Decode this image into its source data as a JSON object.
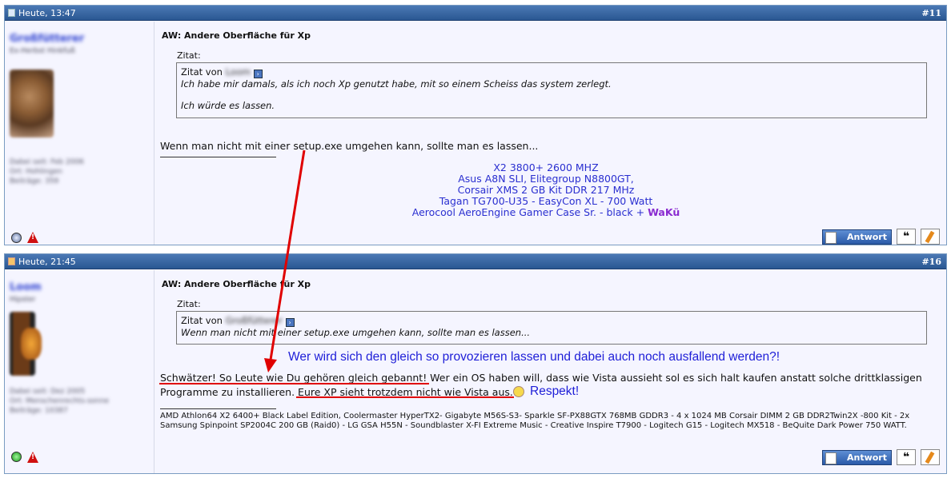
{
  "posts": [
    {
      "time": "Heute, 13:47",
      "number": "#11",
      "username": "Großfütterer",
      "user_title": "Ex-Herbst Hinkfuß",
      "user_meta": [
        "Dabei seit: Feb 2006",
        "Ort: Hohlingen",
        "Beiträge: 359"
      ],
      "title": "AW: Andere Oberfläche für Xp",
      "quote_label": "Zitat:",
      "quote_prefix": "Zitat von",
      "quote_author": "Loom",
      "quote_lines": [
        "Ich habe mir damals, als ich noch Xp genutzt habe, mit so einem Scheiss das system zerlegt.",
        "Ich würde es lassen."
      ],
      "body": "Wenn man nicht mit einer setup.exe umgehen kann, sollte man es lassen...",
      "signature": [
        "X2 3800+ 2600 MHZ",
        "Asus A8N SLI, Elitegroup N8800GT,",
        "Corsair XMS 2 GB Kit DDR 217 MHz",
        "Tagan TG700-U35 - EasyCon XL - 700 Watt",
        "Aerocool AeroEngine Gamer Case Sr. - black + "
      ],
      "signature_bold": "WaKü",
      "reply_label": "Antwort",
      "quote_button": "❝"
    },
    {
      "time": "Heute, 21:45",
      "number": "#16",
      "username": "Loom",
      "user_title": "Hipster",
      "user_meta": [
        "Dabei seit: Dez 2005",
        "Ort: Menschenrechts-sonne",
        "Beiträge: 10387"
      ],
      "title": "AW: Andere Oberfläche für Xp",
      "quote_label": "Zitat:",
      "quote_prefix": "Zitat von",
      "quote_author": "Großfütterer",
      "quote_lines": [
        "Wenn man nicht mit einer setup.exe umgehen kann, sollte man es lassen..."
      ],
      "body_line1": "Schwätzer! So Leute wie Du gehören gleich gebannt! Wer ein OS haben will, dass wie Vista aussieht sol es sich halt kaufen anstatt solche drittklassigen",
      "body_line2": "Programme zu installieren. Eure XP sieht trotzdem nicht wie Vista aus.",
      "signature": "AMD Athlon64 X2 6400+ Black Label Edition, Coolermaster HyperTX2- Gigabyte M56S-S3- Sparkle SF-PX88GTX 768MB GDDR3 - 4 x 1024 MB Corsair DIMM 2 GB DDR2Twin2X -800 Kit - 2x Samsung Spinpoint SP2004C 200 GB (Raid0) - LG GSA H55N - Soundblaster X-FI Extreme Music - Creative Inspire T7900 - Logitech G15 - Logitech MX518 - BeQuite Dark Power 750 WATT.",
      "reply_label": "Antwort",
      "quote_button": "❝"
    }
  ],
  "annotations": {
    "question": "Wer wird sich den gleich so provozieren lassen und dabei auch noch ausfallend werden?!",
    "respekt": "Respekt!"
  },
  "colors": {
    "header": "#2a5792",
    "annotation": "#2020d8",
    "arrow": "#e00000"
  }
}
